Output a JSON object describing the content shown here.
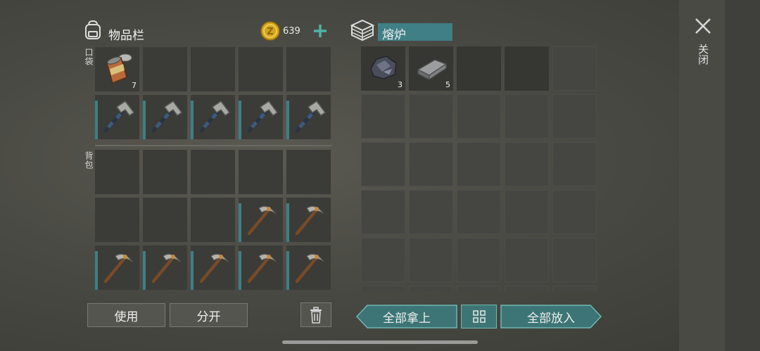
{
  "inventory": {
    "title": "物品栏",
    "icon": "backpack-icon",
    "coins": "639",
    "pocket_label": "口袋",
    "backpack_label": "背包",
    "pocket": [
      {
        "icon": "tin-can-icon",
        "count": "7",
        "dur": false
      },
      null,
      null,
      null,
      null,
      {
        "icon": "hammer-icon",
        "count": "",
        "dur": true
      },
      {
        "icon": "hammer-icon",
        "count": "",
        "dur": true
      },
      {
        "icon": "hammer-icon",
        "count": "",
        "dur": true
      },
      {
        "icon": "hammer-icon",
        "count": "",
        "dur": true
      },
      {
        "icon": "hammer-icon",
        "count": "",
        "dur": true
      }
    ],
    "backpack": [
      null,
      null,
      null,
      null,
      null,
      null,
      null,
      null,
      {
        "icon": "pickaxe-icon",
        "count": "",
        "dur": true
      },
      {
        "icon": "pickaxe-icon",
        "count": "",
        "dur": true
      },
      {
        "icon": "pickaxe-icon",
        "count": "",
        "dur": true
      },
      {
        "icon": "pickaxe-icon",
        "count": "",
        "dur": true
      },
      {
        "icon": "pickaxe-icon",
        "count": "",
        "dur": true
      },
      {
        "icon": "pickaxe-icon",
        "count": "",
        "dur": true
      },
      {
        "icon": "pickaxe-icon",
        "count": "",
        "dur": true
      }
    ],
    "use_label": "使用",
    "split_label": "分开",
    "trash_icon": "trash-icon"
  },
  "furnace": {
    "title": "熔炉",
    "icon": "furnace-icon",
    "slots": [
      {
        "icon": "iron-ore-icon",
        "count": "3"
      },
      {
        "icon": "iron-ingot-icon",
        "count": "5"
      }
    ],
    "take_all_label": "全部拿上",
    "put_all_label": "全部放入",
    "sort_icon": "grid-sort-icon"
  },
  "close_label": "关闭",
  "close_icon": "close-icon",
  "colors": {
    "teal": "#3f7f85",
    "teal_btn": "#3d7576",
    "coin": "#d4a51c"
  }
}
